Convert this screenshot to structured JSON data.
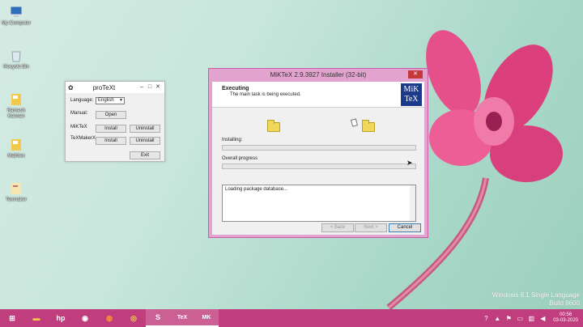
{
  "colors": {
    "taskbar": "#c03d7e",
    "miktex_frame": "#e3a3cf",
    "close_button": "#c7383a",
    "progress_fill": "#06b025",
    "miktex_logo_bg": "#1b3a8a"
  },
  "desktop": {
    "icons": [
      {
        "label": "My Computer",
        "icon": "computer-icon"
      },
      {
        "label": "Recycle Bin",
        "icon": "recycle-bin-icon"
      },
      {
        "label": "Ramesh Kannan",
        "icon": "folder-icon"
      },
      {
        "label": "Mathtex",
        "icon": "folder-icon"
      },
      {
        "label": "Texmaker",
        "icon": "shortcut-icon"
      }
    ]
  },
  "protext": {
    "title": "proTeXt",
    "language_label": "Language:",
    "language_value": "English",
    "manual_label": "Manual:",
    "open_button": "Open",
    "miktex_label": "MiKTeX",
    "texmaker_label": "TeXMakerX",
    "install_button": "Install",
    "uninstall_button": "Uninstall",
    "exit_button": "Exit"
  },
  "miktex": {
    "title": "MiKTeX 2.9.3927 Installer (32-bit)",
    "close_glyph": "✕",
    "header_title": "Executing",
    "header_subtitle": "The main task is being executed.",
    "logo_line1": "MiK",
    "logo_line2": "TeX",
    "installing_label": "Installing:",
    "overall_label": "Overall progress",
    "installing_progress": 0,
    "overall_progress": 0,
    "log_text": "Loading package database...",
    "back_button": "< Back",
    "next_button": "Next >",
    "cancel_button": "Cancel"
  },
  "watermark": {
    "line1": "Windows 8.1 Single Language",
    "line2": "Build 9600"
  },
  "taskbar": {
    "items": [
      {
        "name": "start-icon",
        "glyph": "⊞"
      },
      {
        "name": "file-explorer-icon",
        "glyph": "▬"
      },
      {
        "name": "hp-icon",
        "glyph": "hp"
      },
      {
        "name": "camera-icon",
        "glyph": "◉"
      },
      {
        "name": "firefox-icon",
        "glyph": "◍"
      },
      {
        "name": "chrome-icon",
        "glyph": "◎"
      },
      {
        "name": "app-icon",
        "glyph": "S"
      },
      {
        "name": "tex-icon",
        "glyph": "TeX"
      },
      {
        "name": "miktex-taskbar-icon",
        "glyph": "MK"
      }
    ],
    "time": "00:56",
    "date": "03-03-2020"
  }
}
